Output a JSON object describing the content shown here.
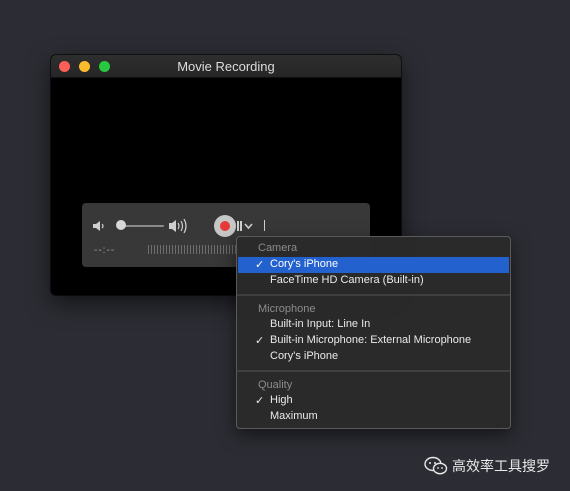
{
  "window": {
    "title": "Movie Recording"
  },
  "controls": {
    "time": "--:--"
  },
  "menu": {
    "camera": {
      "header": "Camera",
      "items": [
        {
          "label": "Cory's iPhone",
          "checked": true,
          "selected": true
        },
        {
          "label": "FaceTime HD Camera (Built-in)",
          "checked": false,
          "selected": false
        }
      ]
    },
    "microphone": {
      "header": "Microphone",
      "items": [
        {
          "label": "Built-in Input: Line In",
          "checked": false
        },
        {
          "label": "Built-in Microphone: External Microphone",
          "checked": true
        },
        {
          "label": "Cory's iPhone",
          "checked": false
        }
      ]
    },
    "quality": {
      "header": "Quality",
      "items": [
        {
          "label": "High",
          "checked": true
        },
        {
          "label": "Maximum",
          "checked": false
        }
      ]
    },
    "checkmark": "✓"
  },
  "watermark": {
    "text": "高效率工具搜罗"
  },
  "colors": {
    "record": "#e53a35",
    "selection": "#2361ce",
    "close": "#fc5f57",
    "minimize": "#fdbc2e",
    "maximize": "#28c940"
  }
}
